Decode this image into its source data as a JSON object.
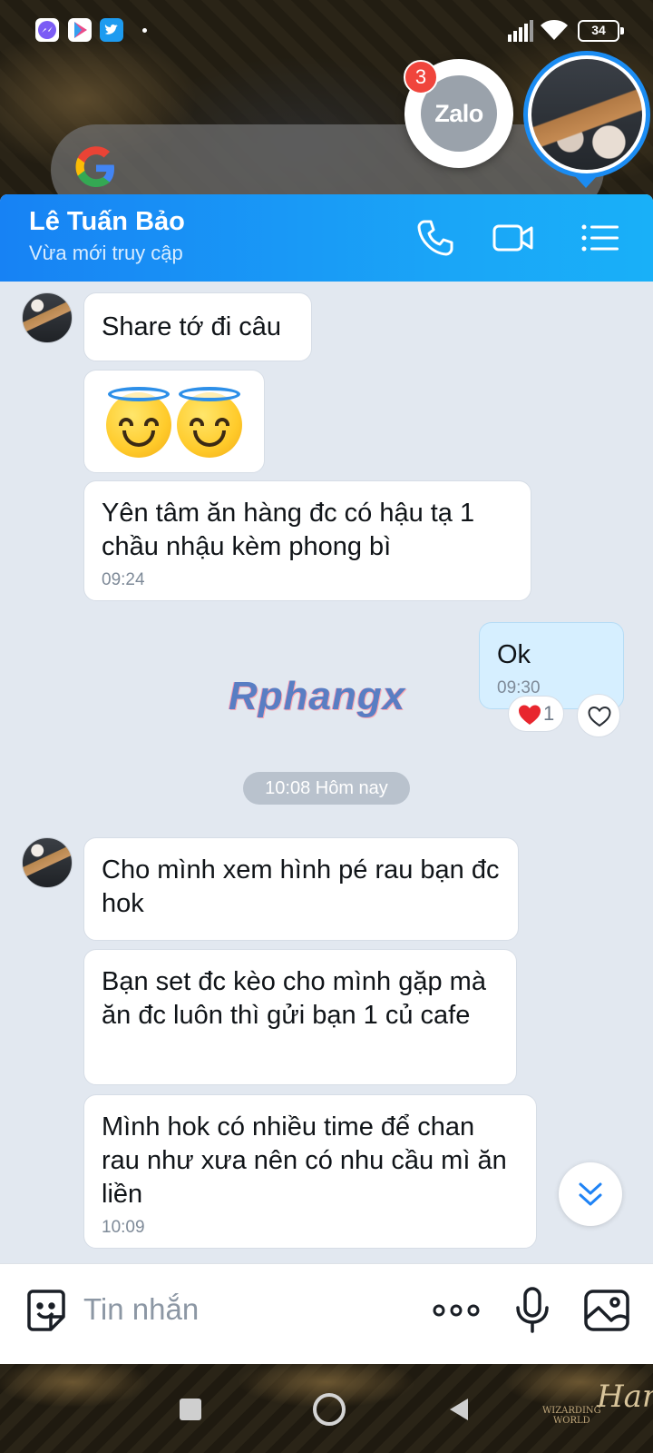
{
  "status_bar": {
    "apps": [
      "messenger-icon",
      "play-store-icon",
      "twitter-icon"
    ],
    "battery": "34"
  },
  "floating": {
    "zalo_label": "Zalo",
    "zalo_badge": "3"
  },
  "chat_header": {
    "contact_name": "Lê Tuấn Bảo",
    "contact_status": "Vừa mới truy cập",
    "actions": [
      "phone-icon",
      "video-call-icon",
      "menu-icon"
    ]
  },
  "messages": {
    "m1": "Share tớ đi câu",
    "m2_emoji": "😇😇",
    "m3": "Yên tâm ăn hàng đc có hậu tạ 1 chầu nhậu kèm phong bì",
    "m3_time": "09:24",
    "m4": "Ok",
    "m4_time": "09:30",
    "m4_reaction_count": "1",
    "date_separator": "10:08 Hôm nay",
    "m5": "Cho mình xem hình pé rau bạn đc hok",
    "m6": "Bạn set đc kèo cho mình gặp mà ăn đc luôn thì gửi bạn 1 củ cafe",
    "m7": "Mình hok có nhiều time để chan rau như xưa nên có nhu cầu mì ăn liền",
    "m7_time": "10:09"
  },
  "watermark": "Rphangx",
  "composer": {
    "placeholder": "Tin nhắn",
    "value": ""
  },
  "wallpaper_text": {
    "wizarding": "WIZARDING",
    "world": "WORLD",
    "harry": "Harr"
  },
  "colors": {
    "header_start": "#1782f4",
    "header_end": "#19b0f8",
    "my_bubble": "#d6efff",
    "chat_bg": "#e2e8f0",
    "badge": "#f0453c"
  }
}
